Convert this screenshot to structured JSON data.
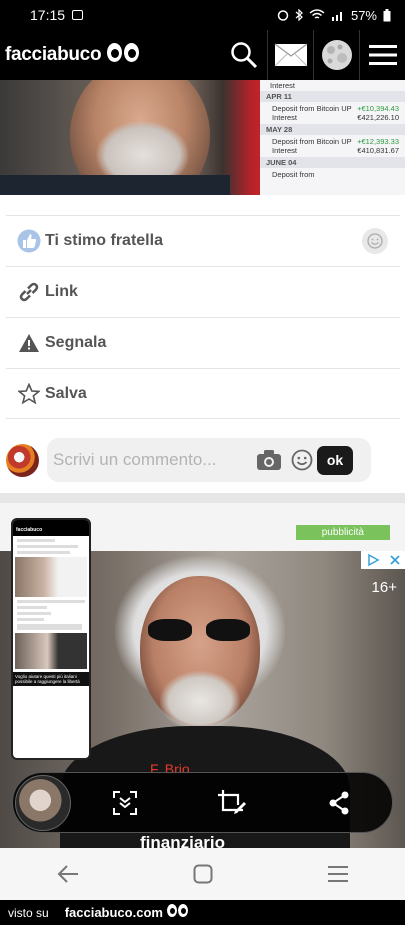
{
  "status_bar": {
    "time": "17:15",
    "battery": "57%"
  },
  "header": {
    "brand": "facciabuco"
  },
  "post_image": {
    "ledger": {
      "interest_top": "Interest",
      "groups": [
        {
          "date": "APR 11",
          "title": "Deposit from Bitcoin UP",
          "sub": "Interest",
          "amount": "+€10,394.43",
          "balance": "€421,226.10"
        },
        {
          "date": "MAY 28",
          "title": "Deposit from Bitcoin UP",
          "sub": "Interest",
          "amount": "+€12,393.33",
          "balance": "€410,831.67"
        },
        {
          "date": "JUNE 04",
          "title": "Deposit from",
          "sub": "",
          "amount": "",
          "balance": ""
        }
      ]
    }
  },
  "actions": {
    "like": "Ti stimo fratella",
    "link": "Link",
    "report": "Segnala",
    "save": "Salva"
  },
  "comment": {
    "placeholder": "Scrivi un commento...",
    "ok": "ok"
  },
  "ad": {
    "badge": "pubblicità",
    "age": "16+",
    "headline": "F. Brio.",
    "bottom_text": "finanziario"
  },
  "thumbnail": {
    "brand": "facciabuco",
    "caption": "Voglio aiutare questi più italiani possibile a raggiungere la libertà"
  },
  "footer": {
    "visto": "visto su",
    "site": "facciabuco.com"
  }
}
